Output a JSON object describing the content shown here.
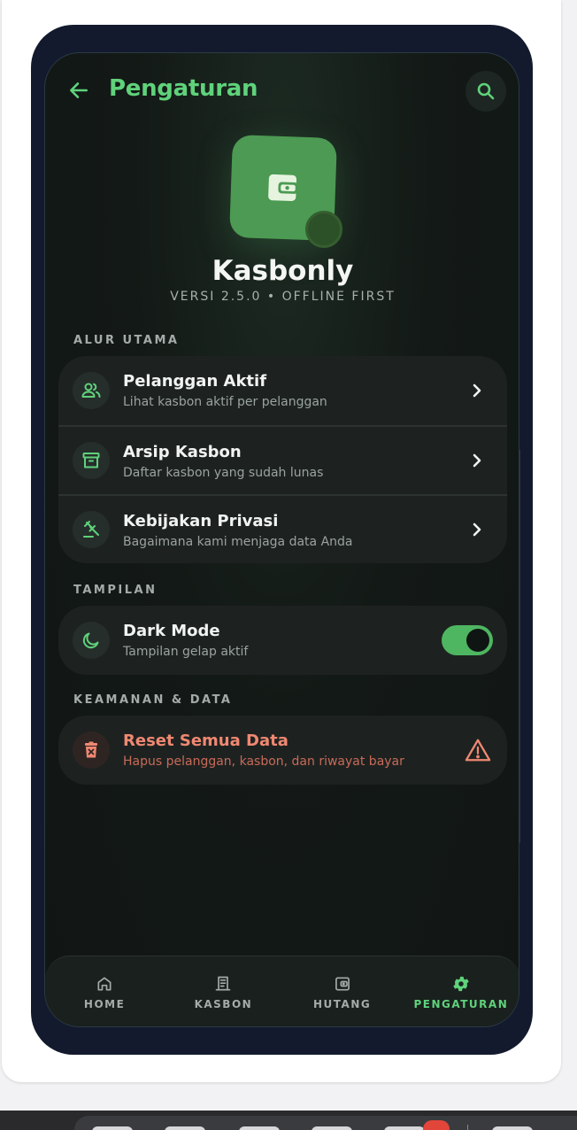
{
  "header": {
    "title": "Pengaturan"
  },
  "app": {
    "name": "Kasbonly",
    "version": "VERSI 2.5.0 • OFFLINE FIRST"
  },
  "sections": {
    "main_flow": {
      "label": "ALUR UTAMA",
      "items": [
        {
          "title": "Pelanggan Aktif",
          "subtitle": "Lihat kasbon aktif per pelanggan",
          "icon": "users-icon"
        },
        {
          "title": "Arsip Kasbon",
          "subtitle": "Daftar kasbon yang sudah lunas",
          "icon": "archive-icon"
        },
        {
          "title": "Kebijakan Privasi",
          "subtitle": "Bagaimana kami menjaga data Anda",
          "icon": "gavel-icon"
        }
      ]
    },
    "display": {
      "label": "TAMPILAN",
      "dark_mode": {
        "title": "Dark Mode",
        "subtitle": "Tampilan gelap aktif",
        "enabled": true
      }
    },
    "security": {
      "label": "KEAMANAN & DATA",
      "reset": {
        "title": "Reset Semua Data",
        "subtitle": "Hapus pelanggan, kasbon, dan riwayat bayar"
      }
    }
  },
  "nav": {
    "items": [
      {
        "label": "HOME",
        "icon": "home-icon",
        "active": false
      },
      {
        "label": "KASBON",
        "icon": "receipt-icon",
        "active": false
      },
      {
        "label": "HUTANG",
        "icon": "wallet-icon",
        "active": false
      },
      {
        "label": "PENGATURAN",
        "icon": "gear-icon",
        "active": true
      }
    ]
  },
  "colors": {
    "accent": "#5fd27b",
    "toggle_on": "#4eb661",
    "danger": "#f08872",
    "background": "#111615",
    "card": "#1d2220"
  }
}
